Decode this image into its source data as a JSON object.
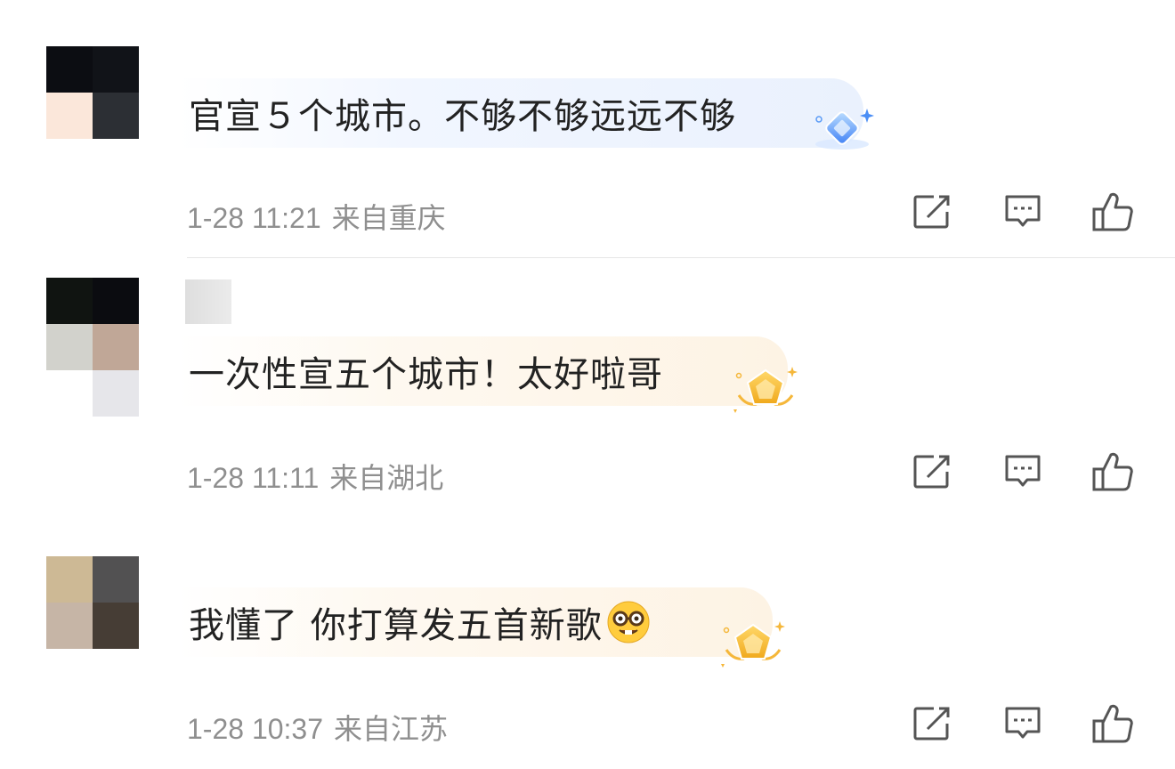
{
  "comments": [
    {
      "text": "官宣５个城市。不够不够远远不够",
      "time": "1-28 11:21",
      "location": "来自重庆",
      "badge": "blue-diamond-badge-icon"
    },
    {
      "text": "一次性宣五个城市！太好啦哥",
      "time": "1-28 11:11",
      "location": "来自湖北",
      "badge": "gold-pentagon-badge-icon"
    },
    {
      "text": "我懂了 你打算发五首新歌",
      "emoji": "nerd-face-emoji-icon",
      "time": "1-28 10:37",
      "location": "来自江苏",
      "badge": "gold-pentagon-badge-icon"
    }
  ],
  "actions": [
    "repost-icon",
    "comment-icon",
    "like-icon"
  ],
  "colors": {
    "text": "#222222",
    "meta": "#8f8f8f",
    "icon": "#555555",
    "blue_bubble": "#eaf1fd",
    "gold_bubble": "#fdf3e4"
  }
}
